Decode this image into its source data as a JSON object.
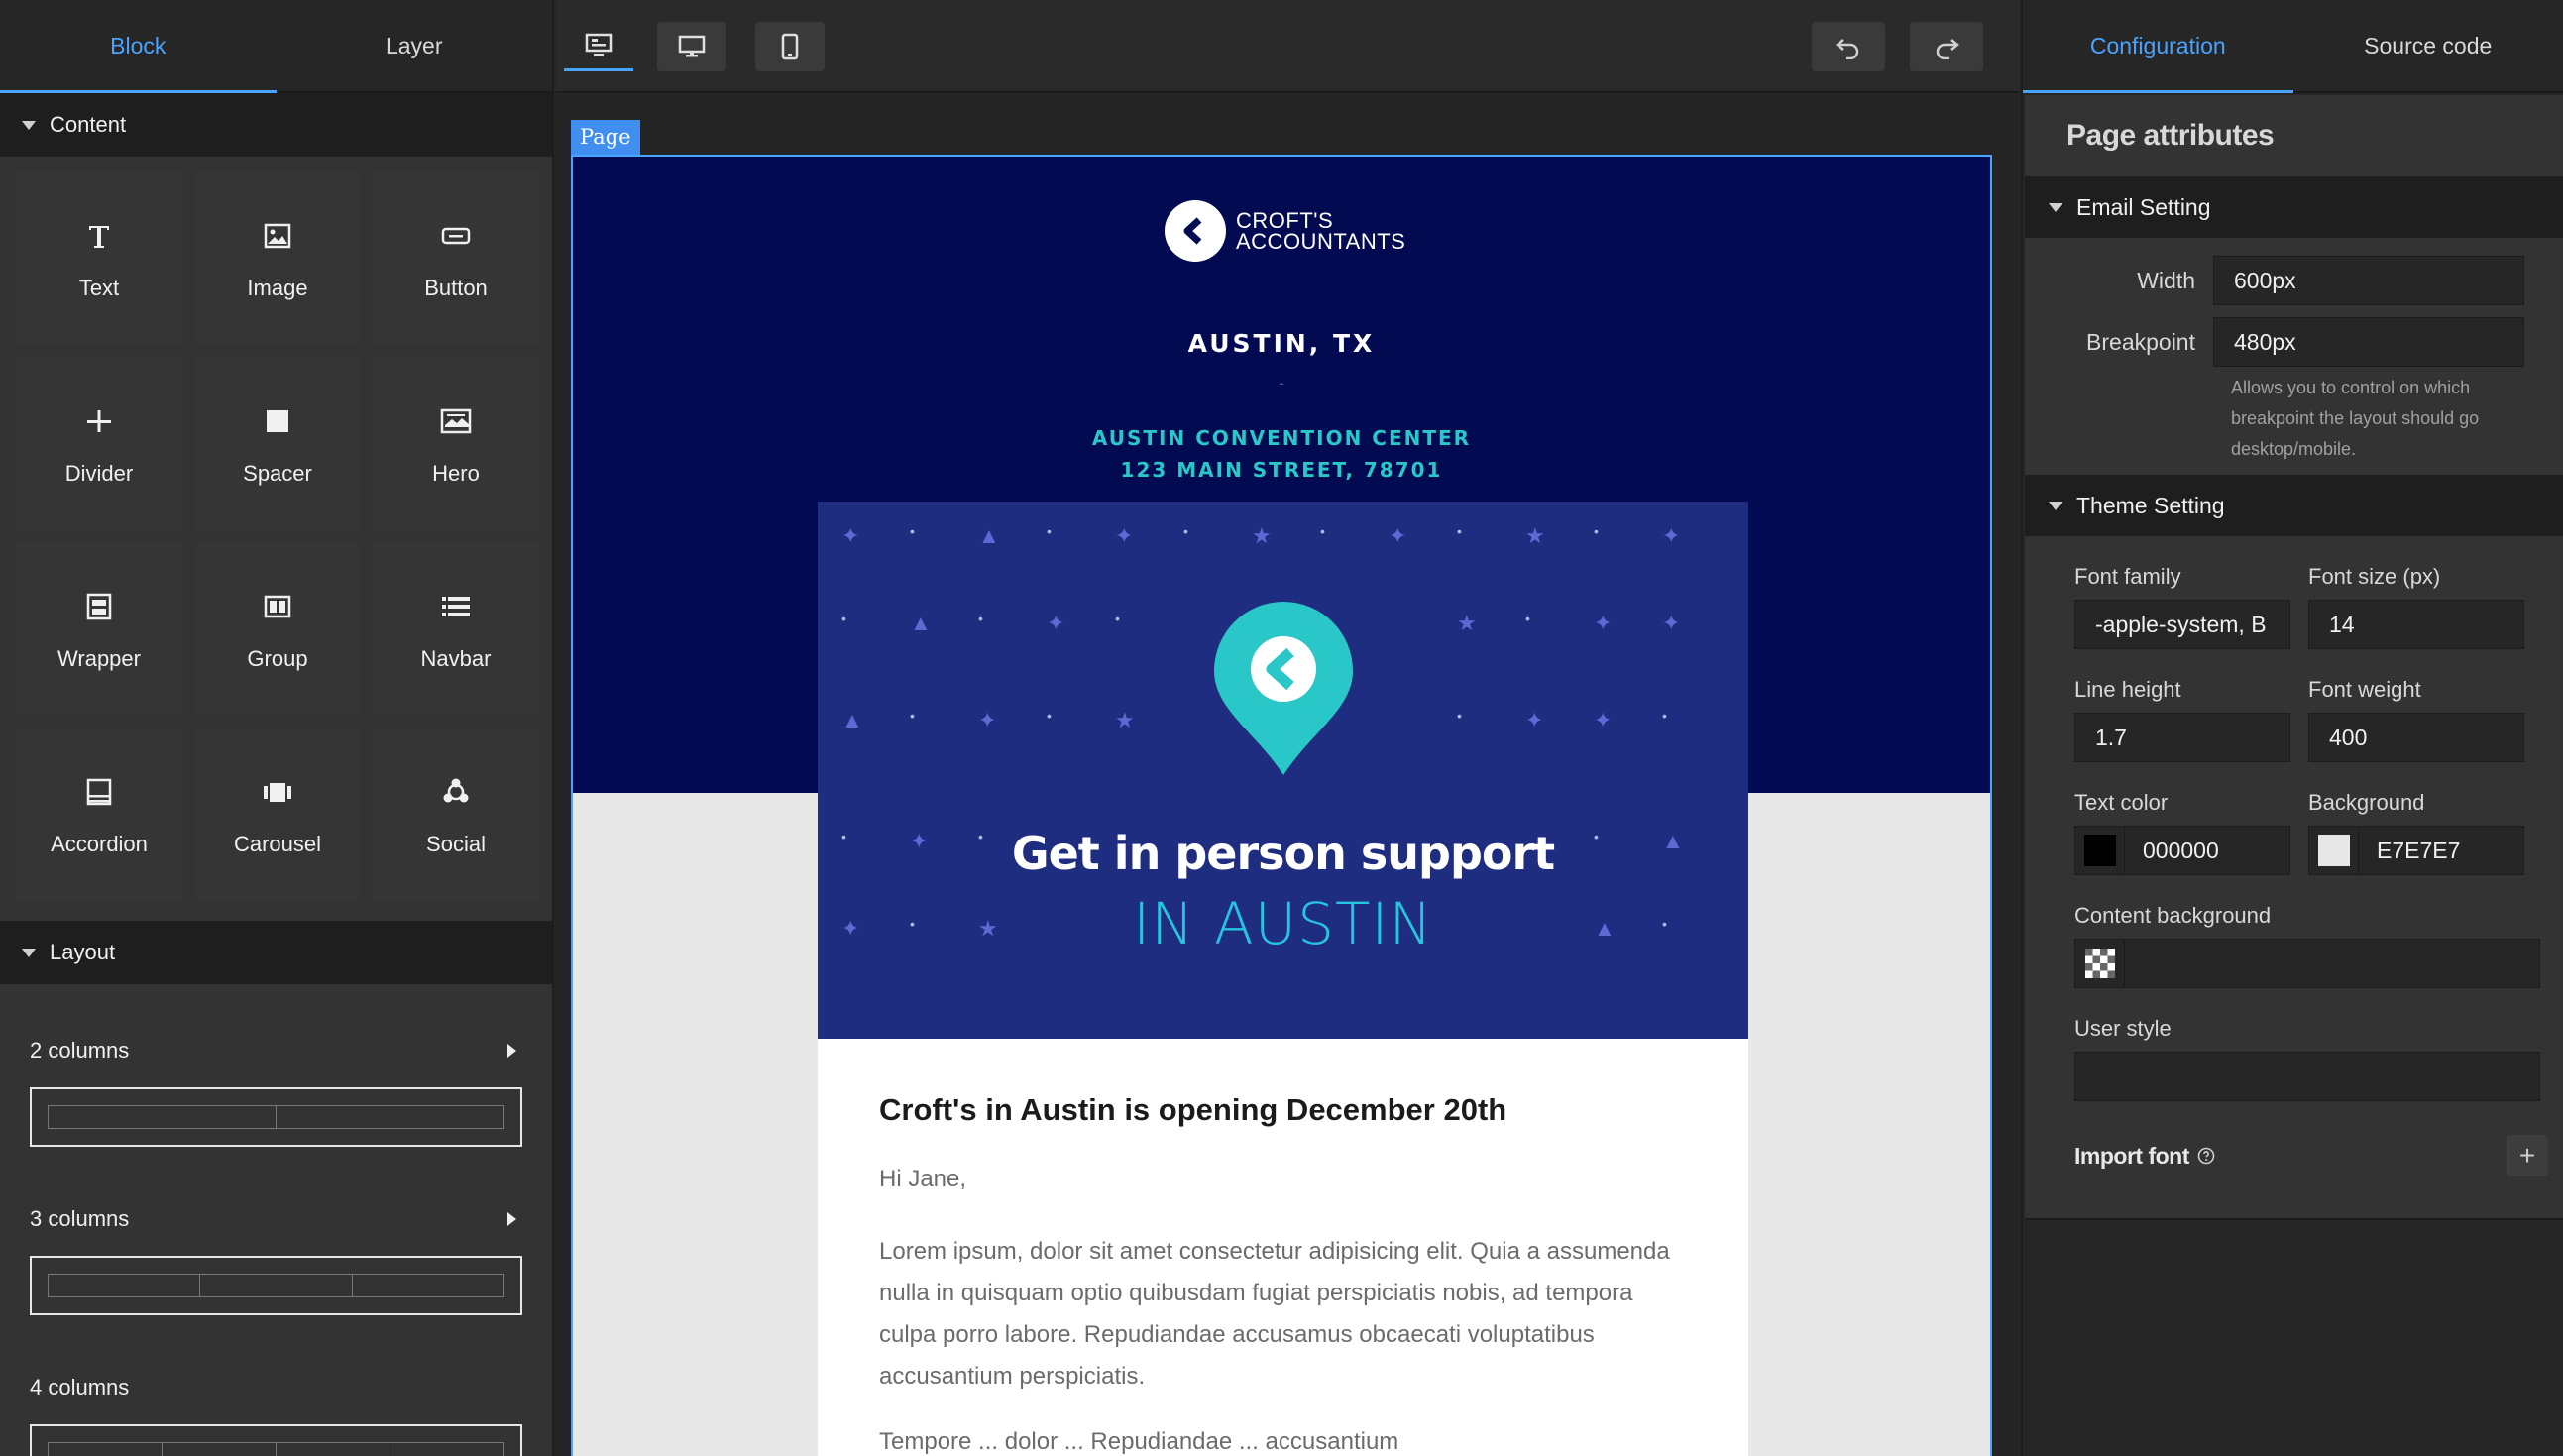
{
  "left_panel": {
    "tabs": [
      {
        "label": "Block",
        "active": true
      },
      {
        "label": "Layer",
        "active": false
      }
    ],
    "content_section": "Content",
    "blocks": [
      {
        "label": "Text",
        "icon": "text-icon"
      },
      {
        "label": "Image",
        "icon": "image-icon"
      },
      {
        "label": "Button",
        "icon": "button-icon"
      },
      {
        "label": "Divider",
        "icon": "divider-icon"
      },
      {
        "label": "Spacer",
        "icon": "spacer-icon"
      },
      {
        "label": "Hero",
        "icon": "hero-icon"
      },
      {
        "label": "Wrapper",
        "icon": "wrapper-icon"
      },
      {
        "label": "Group",
        "icon": "group-icon"
      },
      {
        "label": "Navbar",
        "icon": "navbar-icon"
      },
      {
        "label": "Accordion",
        "icon": "accordion-icon"
      },
      {
        "label": "Carousel",
        "icon": "carousel-icon"
      },
      {
        "label": "Social",
        "icon": "social-icon"
      }
    ],
    "layout_section": "Layout",
    "layouts": [
      {
        "label": "2 columns",
        "cols": 2
      },
      {
        "label": "3 columns",
        "cols": 3
      },
      {
        "label": "4 columns",
        "cols": 4
      }
    ]
  },
  "toolbar": {
    "view_buttons": [
      "preview-icon",
      "desktop-icon",
      "mobile-icon"
    ],
    "undo_icon": "undo-icon",
    "redo_icon": "redo-icon"
  },
  "canvas": {
    "page_tag": "Page",
    "logo_line1": "CROFT'S",
    "logo_line2": "ACCOUNTANTS",
    "city": "AUSTIN, TX",
    "dash": "-",
    "venue_line1": "AUSTIN CONVENTION CENTER",
    "venue_line2": "123 MAIN STREET, 78701",
    "headline": "Get in person support",
    "subline": "IN AUSTIN",
    "content_title": "Croft's in Austin is opening December 20th",
    "greeting": "Hi Jane,",
    "body": "Lorem ipsum, dolor sit amet consectetur adipisicing elit. Quia a assumenda nulla in quisquam optio quibusdam fugiat perspiciatis nobis, ad tempora culpa porro labore. Repudiandae accusamus obcaecati voluptatibus accusantium perspiciatis.",
    "body_cut": "Tempore ... dolor ... Repudiandae ... accusantium",
    "colors": {
      "hero_bg": "#020b52",
      "banner_bg": "#1f2d81",
      "accent_teal": "#29c7c8",
      "subline": "#25c5e0"
    }
  },
  "right_panel": {
    "tabs": [
      {
        "label": "Configuration",
        "active": true
      },
      {
        "label": "Source code",
        "active": false
      }
    ],
    "title": "Page attributes",
    "email_setting": "Email Setting",
    "width_label": "Width",
    "width_value": "600px",
    "breakpoint_label": "Breakpoint",
    "breakpoint_value": "480px",
    "breakpoint_hint": "Allows you to control on which breakpoint the layout should go desktop/mobile.",
    "theme_setting": "Theme Setting",
    "font_family_label": "Font family",
    "font_family_value": "-apple-system, B",
    "font_size_label": "Font size (px)",
    "font_size_value": "14",
    "line_height_label": "Line height",
    "line_height_value": "1.7",
    "font_weight_label": "Font weight",
    "font_weight_value": "400",
    "text_color_label": "Text color",
    "text_color_value": "000000",
    "text_color_hex": "#000000",
    "background_label": "Background",
    "background_value": "E7E7E7",
    "background_hex": "#E7E7E7",
    "content_bg_label": "Content background",
    "user_style_label": "User style",
    "import_font_label": "Import font",
    "accent": "#4aa3ff"
  }
}
